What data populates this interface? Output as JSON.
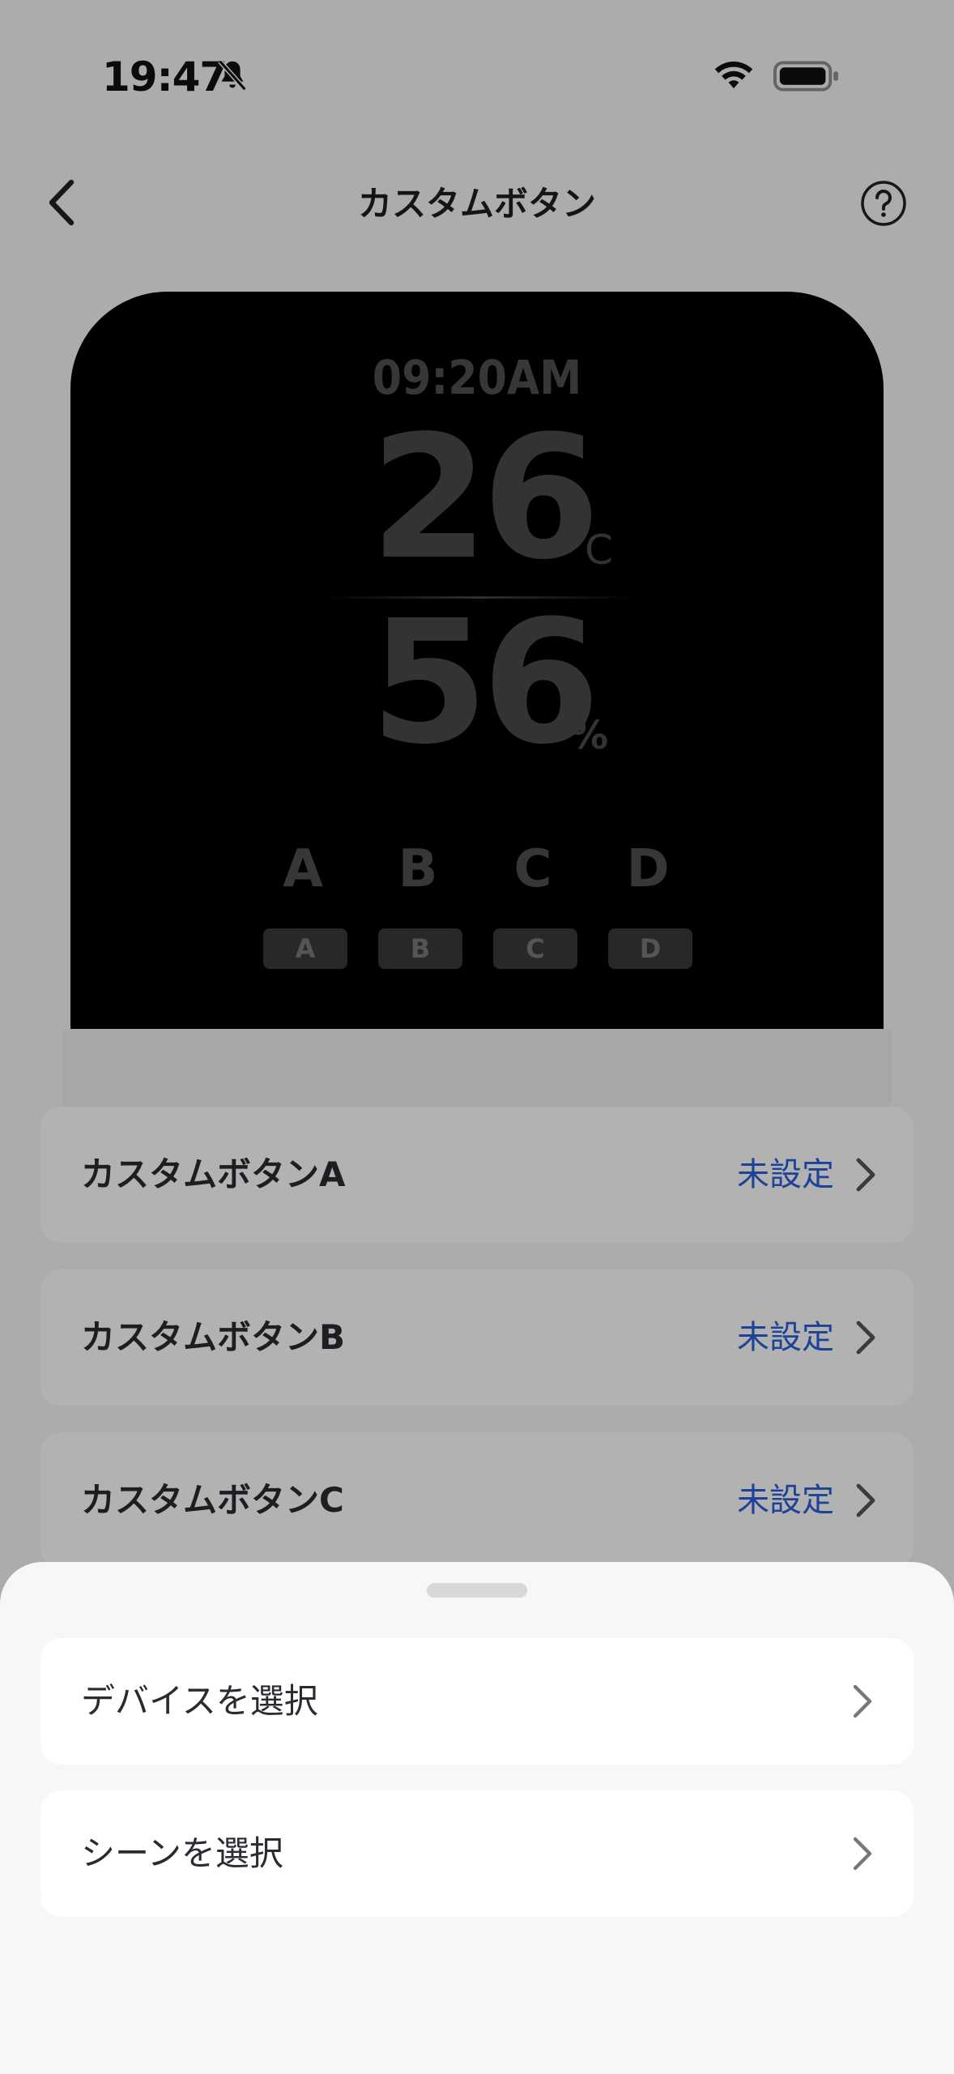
{
  "status_bar": {
    "time": "19:47",
    "icons": [
      "bell-slash-icon",
      "wifi-icon",
      "battery-icon"
    ]
  },
  "header": {
    "title": "カスタムボタン",
    "back_icon": "chevron-left-icon",
    "help_icon": "question-circle-icon"
  },
  "device_preview": {
    "time": "09:20AM",
    "temperature": "26",
    "temperature_unit": "°C",
    "humidity": "56",
    "humidity_unit": "%",
    "buttons": [
      "A",
      "B",
      "C",
      "D"
    ]
  },
  "custom_buttons": [
    {
      "label": "カスタムボタンA",
      "value": "未設定"
    },
    {
      "label": "カスタムボタンB",
      "value": "未設定"
    },
    {
      "label": "カスタムボタンC",
      "value": "未設定"
    }
  ],
  "bottom_sheet": {
    "items": [
      {
        "label": "デバイスを選択"
      },
      {
        "label": "シーンを選択"
      }
    ]
  },
  "colors": {
    "accent": "#2b5fd9",
    "overlay": "rgba(0,0,0,0.30)",
    "sheet_bg": "#f7f7f7",
    "device_bg": "#000000"
  }
}
